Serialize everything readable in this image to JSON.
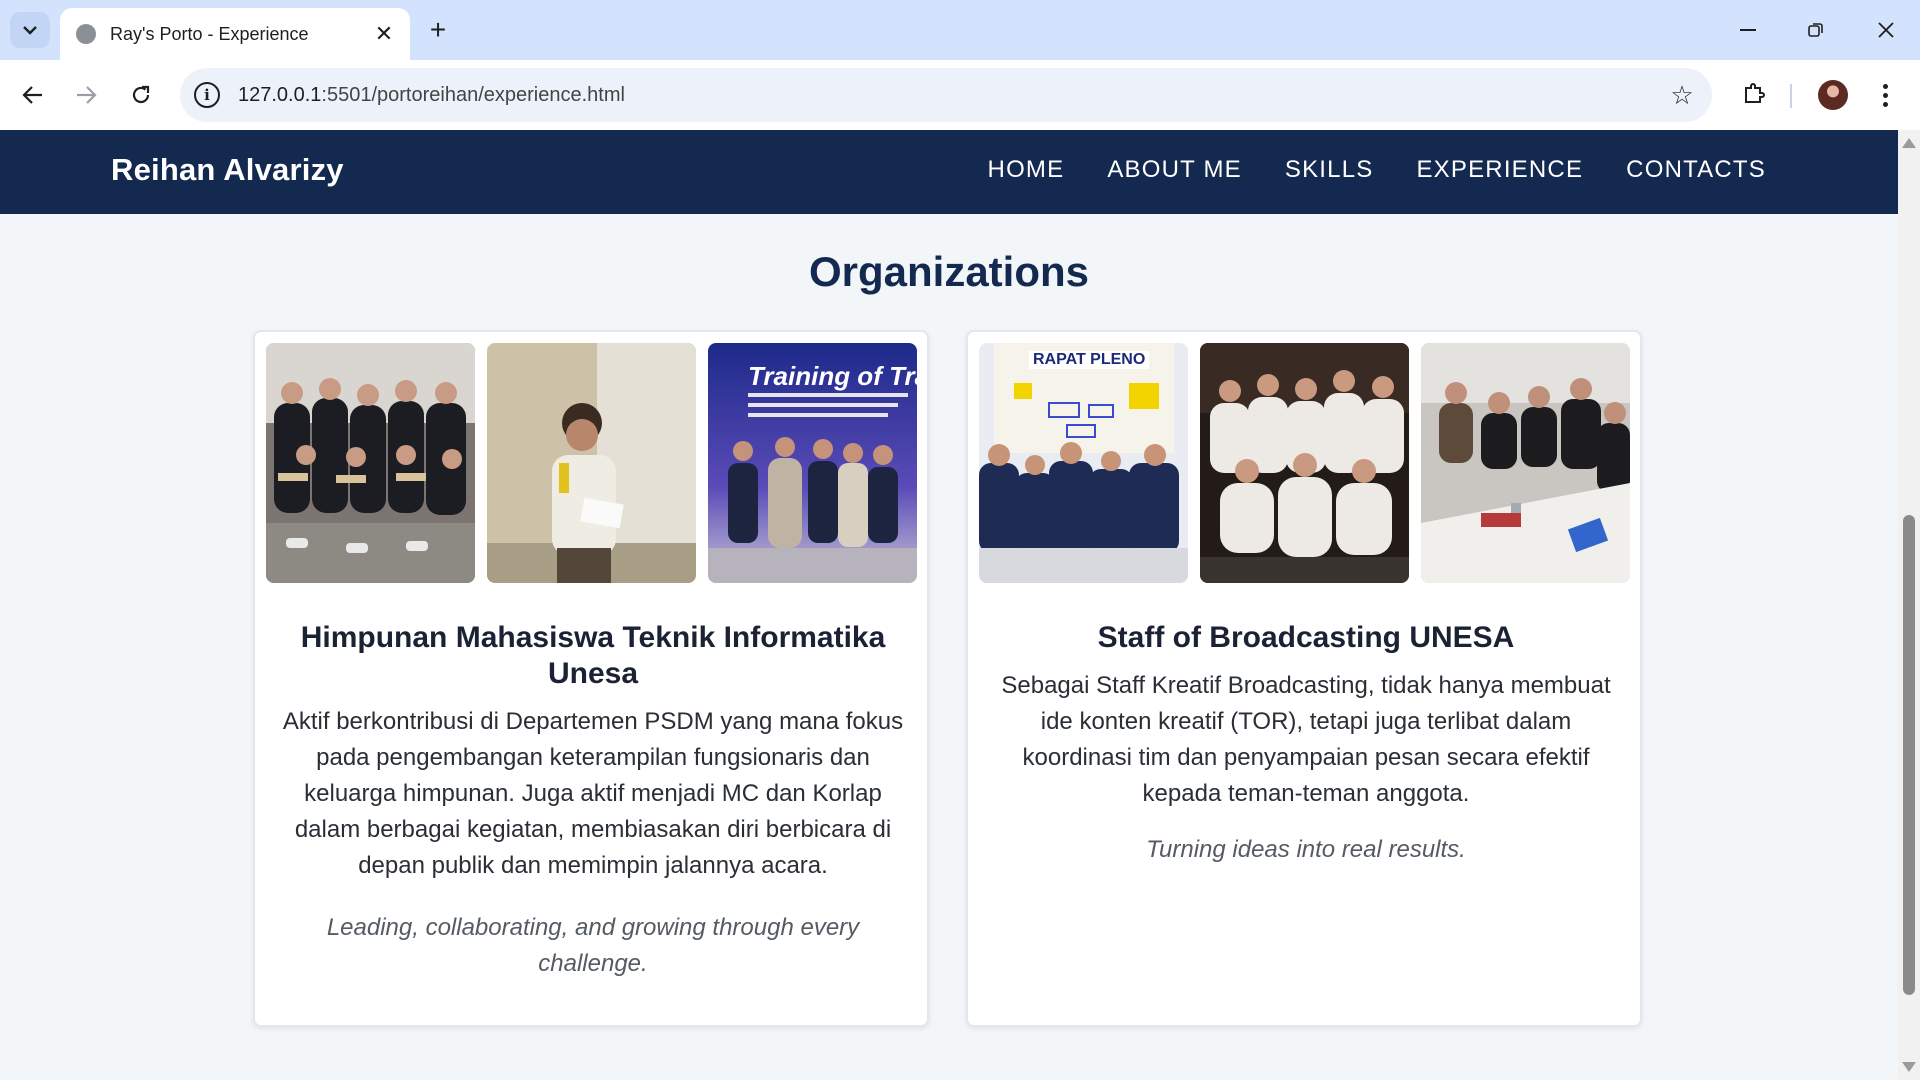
{
  "browser": {
    "tab_title": "Ray's Porto - Experience",
    "url_host": "127.0.0.1",
    "url_rest": ":5501/portoreihan/experience.html"
  },
  "site": {
    "brand": "Reihan Alvarizy",
    "nav": [
      "HOME",
      "ABOUT ME",
      "SKILLS",
      "EXPERIENCE",
      "CONTACTS"
    ],
    "accent_color": "#14294f"
  },
  "section": {
    "title": "Organizations"
  },
  "cards": [
    {
      "title": "Himpunan Mahasiswa Teknik Informatika Unesa",
      "body": "Aktif berkontribusi di Departemen PSDM yang mana fokus pada pengembangan keterampilan fungsionaris dan keluarga himpunan. Juga aktif menjadi MC dan Korlap dalam berbagai kegiatan, membiasakan diri berbicara di depan publik dan memimpin jalannya acara.",
      "tagline": "Leading, collaborating, and growing through every challenge.",
      "photo_text": "Training of Tra"
    },
    {
      "title": "Staff of Broadcasting UNESA",
      "body": "Sebagai Staff Kreatif Broadcasting, tidak hanya membuat ide konten kreatif (TOR), tetapi juga terlibat dalam koordinasi tim dan penyampaian pesan secara efektif kepada teman-teman anggota.",
      "tagline": "Turning ideas into real results.",
      "photo_text": "RAPAT PLENO"
    }
  ]
}
